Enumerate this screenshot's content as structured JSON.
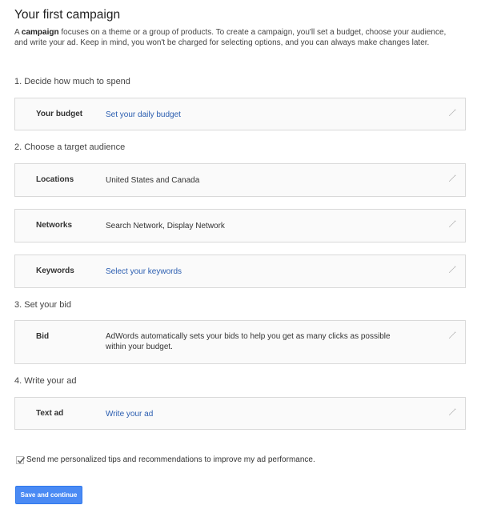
{
  "title": "Your first campaign",
  "intro": {
    "prefix": "A ",
    "bold": "campaign",
    "rest": " focuses on a theme or a group of products. To create a campaign, you'll set a budget, choose your audience, and write your ad. Keep in mind, you won't be charged for selecting options, and you can always make changes later."
  },
  "sections": {
    "spend": "1. Decide how much to spend",
    "audience": "2. Choose a target audience",
    "bid": "3. Set your bid",
    "ad": "4. Write your ad"
  },
  "cards": {
    "budget": {
      "label": "Your budget",
      "value": "Set your daily budget"
    },
    "locations": {
      "label": "Locations",
      "value": "United States and Canada"
    },
    "networks": {
      "label": "Networks",
      "value": "Search Network, Display Network"
    },
    "keywords": {
      "label": "Keywords",
      "value": "Select your keywords"
    },
    "bid": {
      "label": "Bid",
      "value": "AdWords automatically sets your bids to help you get as many clicks as possible within your budget."
    },
    "textad": {
      "label": "Text ad",
      "value": "Write your ad"
    }
  },
  "edit_icon": "pencil-icon",
  "tips": {
    "label": "Send me personalized tips and recommendations to improve my ad performance.",
    "checked": true
  },
  "save_button": "Save and continue",
  "colors": {
    "link": "#2a5db0",
    "button": "#4a8af4",
    "card_bg": "#fafafa",
    "card_border": "#d9d9d9"
  }
}
